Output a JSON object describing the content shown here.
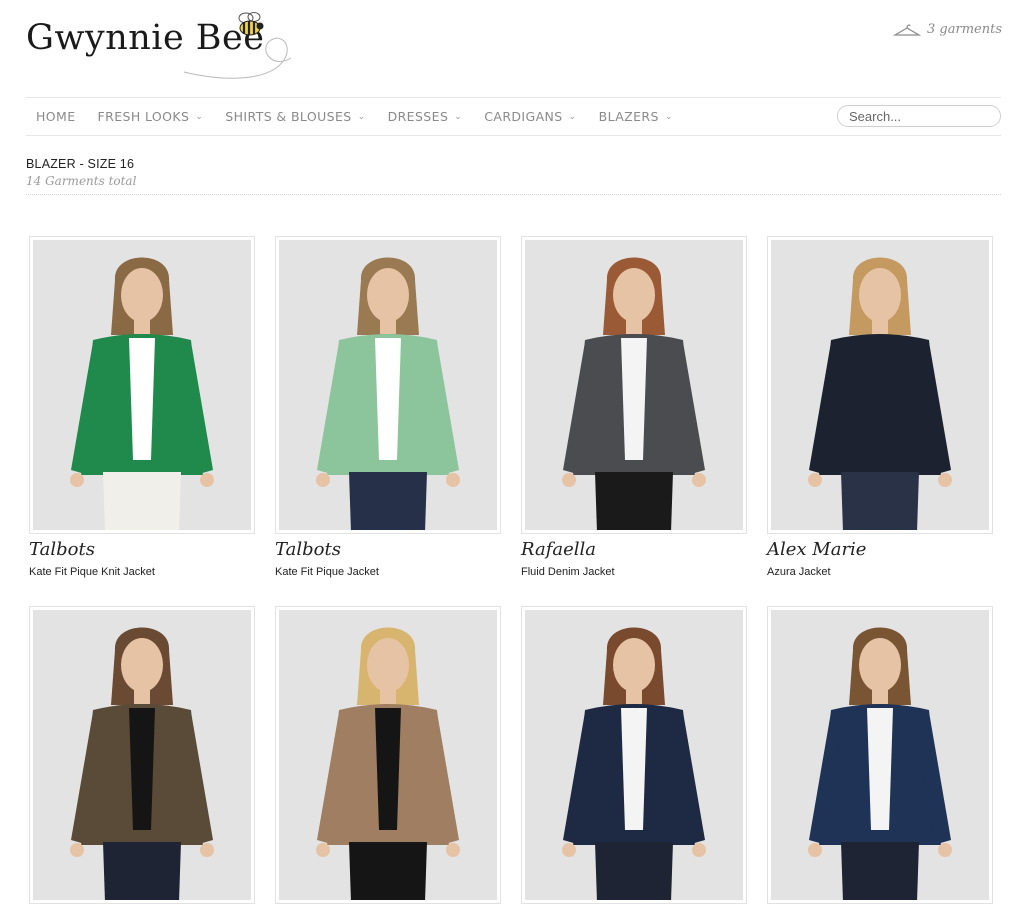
{
  "brand": {
    "logo_text": "Gwynnie Bee"
  },
  "cart": {
    "label": "3 garments"
  },
  "nav": {
    "items": [
      {
        "label": "HOME",
        "dropdown": false
      },
      {
        "label": "FRESH LOOKS",
        "dropdown": true
      },
      {
        "label": "SHIRTS & BLOUSES",
        "dropdown": true
      },
      {
        "label": "DRESSES",
        "dropdown": true
      },
      {
        "label": "CARDIGANS",
        "dropdown": true
      },
      {
        "label": "BLAZERS",
        "dropdown": true
      }
    ],
    "search_placeholder": "Search..."
  },
  "page": {
    "title": "BLAZER - SIZE 16",
    "count": "14 Garments total"
  },
  "products": [
    {
      "brand": "Talbots",
      "name": "Kate Fit Pique Knit Jacket",
      "jacket_color": "#1f8a4c",
      "inner_color": "#ffffff",
      "pants_color": "#f1efe9",
      "hair_color": "#8a6a45"
    },
    {
      "brand": "Talbots",
      "name": "Kate Fit Pique Jacket",
      "jacket_color": "#8cc49b",
      "inner_color": "#ffffff",
      "pants_color": "#263048",
      "hair_color": "#9a7a52"
    },
    {
      "brand": "Rafaella",
      "name": "Fluid Denim Jacket",
      "jacket_color": "#4a4c50",
      "inner_color": "#f4f4f4",
      "pants_color": "#1a1a1a",
      "hair_color": "#9a5a35"
    },
    {
      "brand": "Alex Marie",
      "name": "Azura Jacket",
      "jacket_color": "#1c2230",
      "inner_color": "#1c2230",
      "pants_color": "#2a3248",
      "hair_color": "#c49a60"
    },
    {
      "brand": "",
      "name": "",
      "jacket_color": "#5a4a38",
      "inner_color": "#151515",
      "pants_color": "#1e2433",
      "hair_color": "#6a4a32"
    },
    {
      "brand": "",
      "name": "",
      "jacket_color": "#a07e62",
      "inner_color": "#151515",
      "pants_color": "#151515",
      "hair_color": "#d8b56e"
    },
    {
      "brand": "",
      "name": "",
      "jacket_color": "#1e2a44",
      "inner_color": "#f4f4f4",
      "pants_color": "#1e2433",
      "hair_color": "#7a4a2e"
    },
    {
      "brand": "",
      "name": "",
      "jacket_color": "#1f3357",
      "inner_color": "#f4f4f4",
      "pants_color": "#1e2433",
      "hair_color": "#7a5534"
    }
  ]
}
